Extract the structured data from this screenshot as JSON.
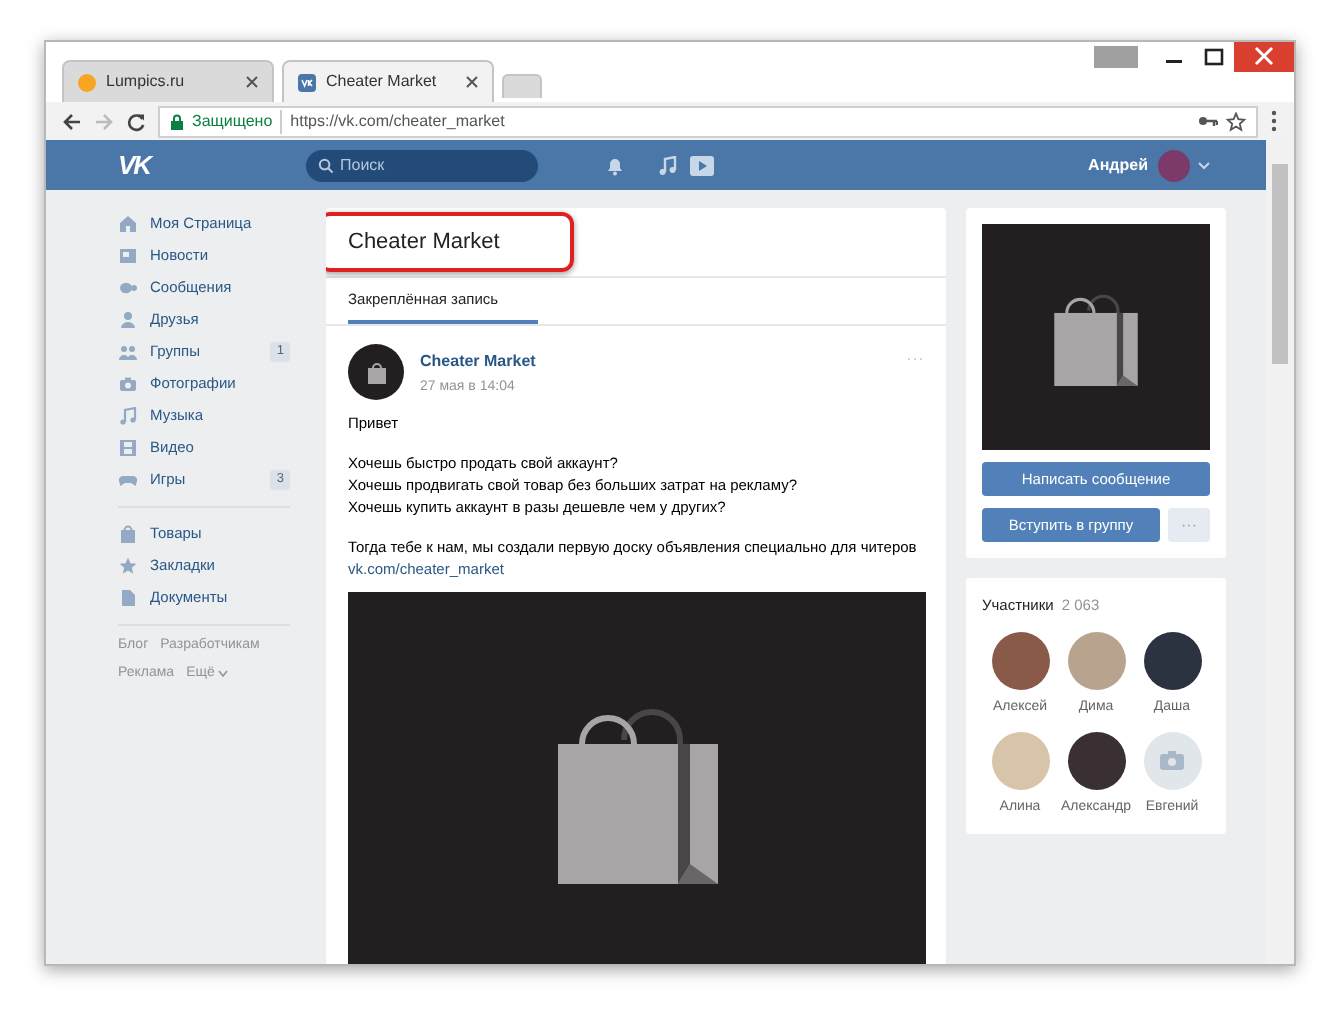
{
  "browser": {
    "tabs": [
      {
        "label": "Lumpics.ru",
        "selected": false
      },
      {
        "label": "Cheater Market",
        "selected": true
      }
    ],
    "secure_label": "Защищено",
    "url": "https://vk.com/cheater_market"
  },
  "header": {
    "logo": "VK",
    "search": {
      "placeholder": "Поиск"
    },
    "user_name": "Андрей"
  },
  "sidebar": {
    "items": [
      {
        "label": "Моя Страница"
      },
      {
        "label": "Новости"
      },
      {
        "label": "Сообщения"
      },
      {
        "label": "Друзья"
      },
      {
        "label": "Группы",
        "count": "1"
      },
      {
        "label": "Фотографии"
      },
      {
        "label": "Музыка"
      },
      {
        "label": "Видео"
      },
      {
        "label": "Игры",
        "count": "3"
      }
    ],
    "extra_items": [
      {
        "label": "Товары"
      },
      {
        "label": "Закладки"
      },
      {
        "label": "Документы"
      }
    ],
    "footer_links": [
      "Блог",
      "Разработчикам",
      "Реклама",
      "Ещё"
    ]
  },
  "group": {
    "title": "Cheater Market",
    "title_highlighted": true,
    "tabs": [
      {
        "label": "Закреплённая запись",
        "selected": true
      }
    ],
    "post": {
      "author": "Cheater Market",
      "date": "27 мая в 14:04",
      "menu": "···",
      "paragraphs": [
        [
          "Привет"
        ],
        [
          "Хочешь быстро продать свой аккаунт?",
          "Хочешь продвигать свой товар без больших затрат на рекламу?",
          "Хочешь купить аккаунт в разы дешевле чем у других?"
        ],
        [
          "Тогда тебе к нам, мы создали первую доску объявления специально для читеров"
        ]
      ],
      "link": "vk.com/cheater_market"
    }
  },
  "actions": {
    "message": "Написать сообщение",
    "join": "Вступить в группу",
    "more": "···"
  },
  "members": {
    "title": "Участники",
    "count": "2 063",
    "people": [
      {
        "name": "Алексей",
        "has_photo": true
      },
      {
        "name": "Дима",
        "has_photo": true
      },
      {
        "name": "Даша",
        "has_photo": true
      },
      {
        "name": "Алина",
        "has_photo": true
      },
      {
        "name": "Александр",
        "has_photo": true
      },
      {
        "name": "Евгений",
        "has_photo": false
      }
    ]
  }
}
